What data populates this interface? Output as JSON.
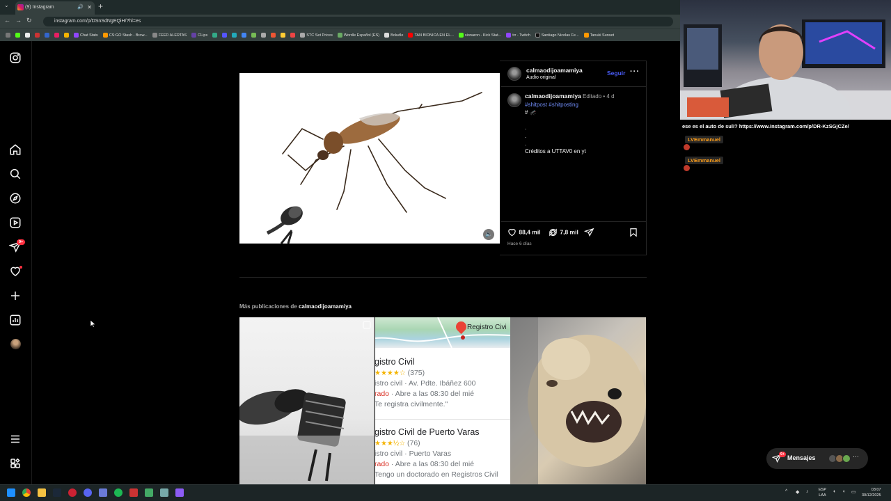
{
  "browser": {
    "tab_title": "(9) Instagram",
    "url": "instagram.com/p/DSnSdNgEQiH/?hl=es",
    "bookmarks": [
      "Chat Stats",
      "CS:GO Stash - Brow...",
      "FEED ALERTAS",
      "CLips",
      "STC Set Prices",
      "Wordle Español (ES)",
      "Boludle",
      "TAN BIONICA EN EL...",
      "sionaron - Kick Stat...",
      "trr - Twitch",
      "Santiago Nicolas Fe...",
      "Tanuki Sunset"
    ]
  },
  "post": {
    "author": "calmaodijoamamiya",
    "audio": "Audio original",
    "follow_label": "Seguir",
    "caption_author": "calmaodijoamamiya",
    "edited": "Editado •",
    "age": "4 d",
    "hashtags": "#shitpost #shitposting",
    "caption_line2": "# 🦟",
    "dot1": ".",
    "dot2": ".",
    "dot3": ".",
    "credits": "Créditos a UTTAV0 en yt",
    "likes": "88,4 mil",
    "reposts": "7,8 mil",
    "time_ago": "Hace 6 días"
  },
  "more_posts": {
    "prefix": "Más publicaciones de",
    "author": "calmaodijoamamiya"
  },
  "registro": {
    "map_label": "Registro Civi",
    "r1_name": "gistro Civil",
    "r1_stars": "★★★★☆",
    "r1_count": "(375)",
    "r1_addr": "istro civil · Av. Pdte. Ibáñez 600",
    "r1_closed": "rado",
    "r1_hours": " · Abre a las 08:30 del mié",
    "r1_review": "Te registra civilmente.\"",
    "r2_name": "gistro Civil de Puerto Varas",
    "r2_stars": "★★★½☆",
    "r2_count": "(76)",
    "r2_addr": "istro civil · Puerto Varas",
    "r2_closed": "rado",
    "r2_hours": " · Abre a las 08:30 del mié",
    "r2_review": "Tengo un doctorado en Registros Civil"
  },
  "chat": {
    "message": "ese es el auto de suli? https://www.instagram.com/p/DR-KzSGjCZe/",
    "user1": "LVEmmanuel",
    "user2": "LVEmmanuel"
  },
  "messages": {
    "label": "Mensajes",
    "badge": "9+"
  },
  "sidebar": {
    "notif_badge": "9+"
  },
  "taskbar": {
    "lang1": "ESP",
    "lang2": "LAA",
    "time": "03:07",
    "date": "30/12/2025"
  }
}
